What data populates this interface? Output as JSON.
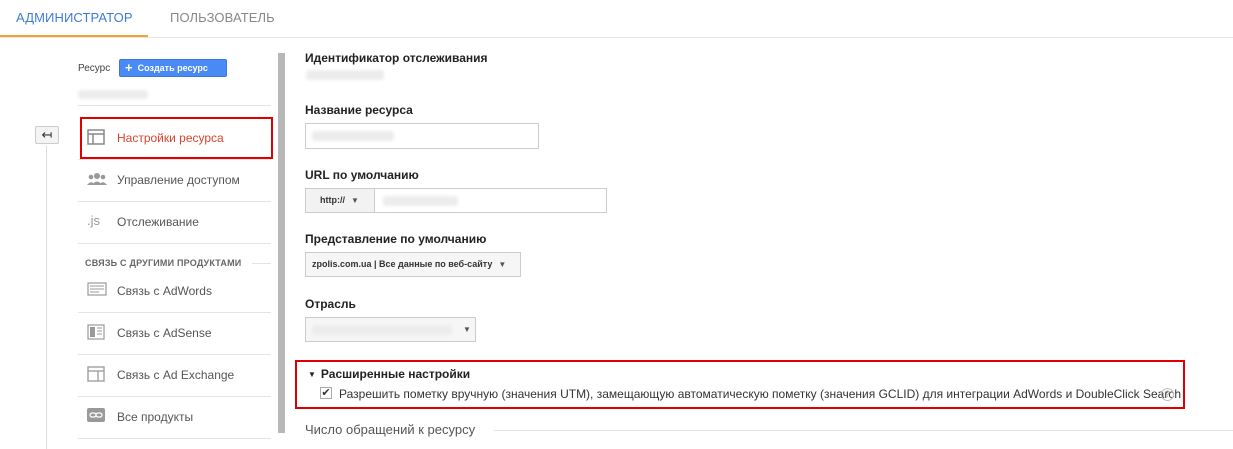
{
  "tabs": {
    "admin": "АДМИНИСТРАТОР",
    "user": "ПОЛЬЗОВАТЕЛЬ"
  },
  "sidebar": {
    "back_icon": "↤",
    "resource_label": "Ресурс",
    "create_button": "Создать ресурс",
    "items": [
      {
        "label": "Настройки ресурса",
        "icon": "window-icon",
        "active": true
      },
      {
        "label": "Управление доступом",
        "icon": "people-icon"
      },
      {
        "label": "Отслеживание",
        "icon": "js-icon",
        "glyph": ".js"
      }
    ],
    "section_title": "СВЯЗЬ С ДРУГИМИ ПРОДУКТАМИ",
    "links": [
      {
        "label": "Связь с AdWords",
        "icon": "adwords-icon"
      },
      {
        "label": "Связь с AdSense",
        "icon": "adsense-icon"
      },
      {
        "label": "Связь с Ad Exchange",
        "icon": "adexchange-icon"
      },
      {
        "label": "Все продукты",
        "icon": "link-icon"
      }
    ]
  },
  "form": {
    "tracking_id_label": "Идентификатор отслеживания",
    "resource_name_label": "Название ресурса",
    "default_url_label": "URL по умолчанию",
    "protocol": "http://",
    "default_view_label": "Представление по умолчанию",
    "default_view_value": "zpolis.com.ua | Все данные по веб-сайту",
    "industry_label": "Отрасль",
    "advanced_title": "Расширенные настройки",
    "allow_manual_tagging": "Разрешить пометку вручную (значения UTM), замещающую автоматическую пометку (значения GCLID) для интеграции AdWords и DoubleClick Search",
    "manual_tagging_checked": true,
    "help_icon": "?",
    "hits_section_label": "Число обращений к ресурсу"
  },
  "colors": {
    "active_tab": "#3d7bd9",
    "tab_underline": "#f2a337",
    "create_button": "#4a8af4",
    "active_nav": "#d9432c",
    "highlight_box": "#e00000"
  }
}
